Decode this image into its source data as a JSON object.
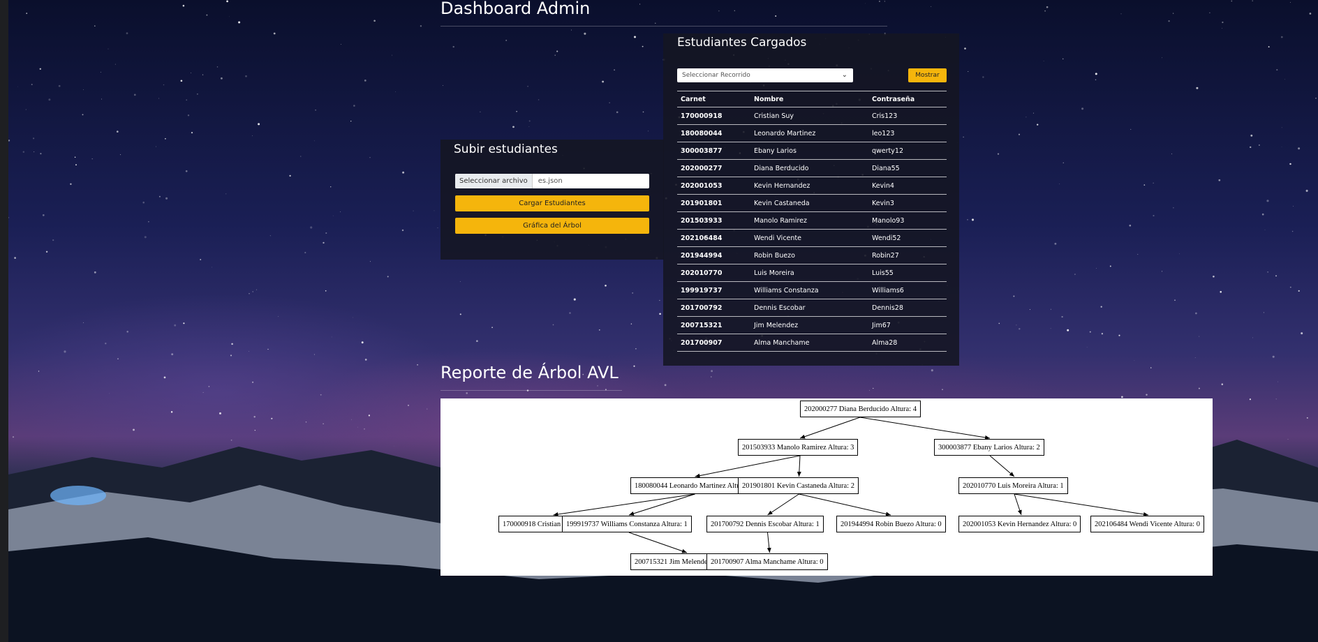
{
  "page": {
    "title": "Dashboard Admin",
    "report_title": "Reporte de Árbol AVL"
  },
  "upload": {
    "heading": "Subir estudiantes",
    "file_button": "Seleccionar archivo",
    "file_name": "es.json",
    "load_button": "Cargar Estudiantes",
    "tree_button": "Gráfica del Árbol"
  },
  "students": {
    "heading": "Estudiantes Cargados",
    "select_placeholder": "Seleccionar Recorrido",
    "show_button": "Mostrar",
    "columns": [
      "Carnet",
      "Nombre",
      "Contraseña"
    ],
    "rows": [
      [
        "170000918",
        "Cristian Suy",
        "Cris123"
      ],
      [
        "180080044",
        "Leonardo Martinez",
        "leo123"
      ],
      [
        "300003877",
        "Ebany Larios",
        "qwerty12"
      ],
      [
        "202000277",
        "Diana Berducido",
        "Diana55"
      ],
      [
        "202001053",
        "Kevin Hernandez",
        "Kevin4"
      ],
      [
        "201901801",
        "Kevin Castaneda",
        "Kevin3"
      ],
      [
        "201503933",
        "Manolo Ramirez",
        "Manolo93"
      ],
      [
        "202106484",
        "Wendi Vicente",
        "Wendi52"
      ],
      [
        "201944994",
        "Robin Buezo",
        "Robin27"
      ],
      [
        "202010770",
        "Luis Moreira",
        "Luis55"
      ],
      [
        "199919737",
        "Williams Constanza",
        "Williams6"
      ],
      [
        "201700792",
        "Dennis Escobar",
        "Dennis28"
      ],
      [
        "200715321",
        "Jim Melendez",
        "Jim67"
      ],
      [
        "201700907",
        "Alma Manchame",
        "Alma28"
      ]
    ]
  },
  "tree": {
    "nodes": [
      "202000277 Diana Berducido Altura: 4",
      "201503933 Manolo Ramirez Altura: 3",
      "300003877 Ebany Larios Altura: 2",
      "180080044 Leonardo Martinez Altura: 2",
      "201901801 Kevin Castaneda Altura: 2",
      "202010770 Luis Moreira Altura: 1",
      "170000918 Cristian Suy Altura: 0",
      "199919737 Williams Constanza Altura: 1",
      "201700792 Dennis Escobar Altura: 1",
      "201944994 Robin Buezo Altura: 0",
      "202001053 Kevin Hernandez Altura: 0",
      "202106484 Wendi Vicente Altura: 0",
      "200715321 Jim Melendez Altura: 0",
      "201700907 Alma Manchame Altura: 0"
    ]
  }
}
